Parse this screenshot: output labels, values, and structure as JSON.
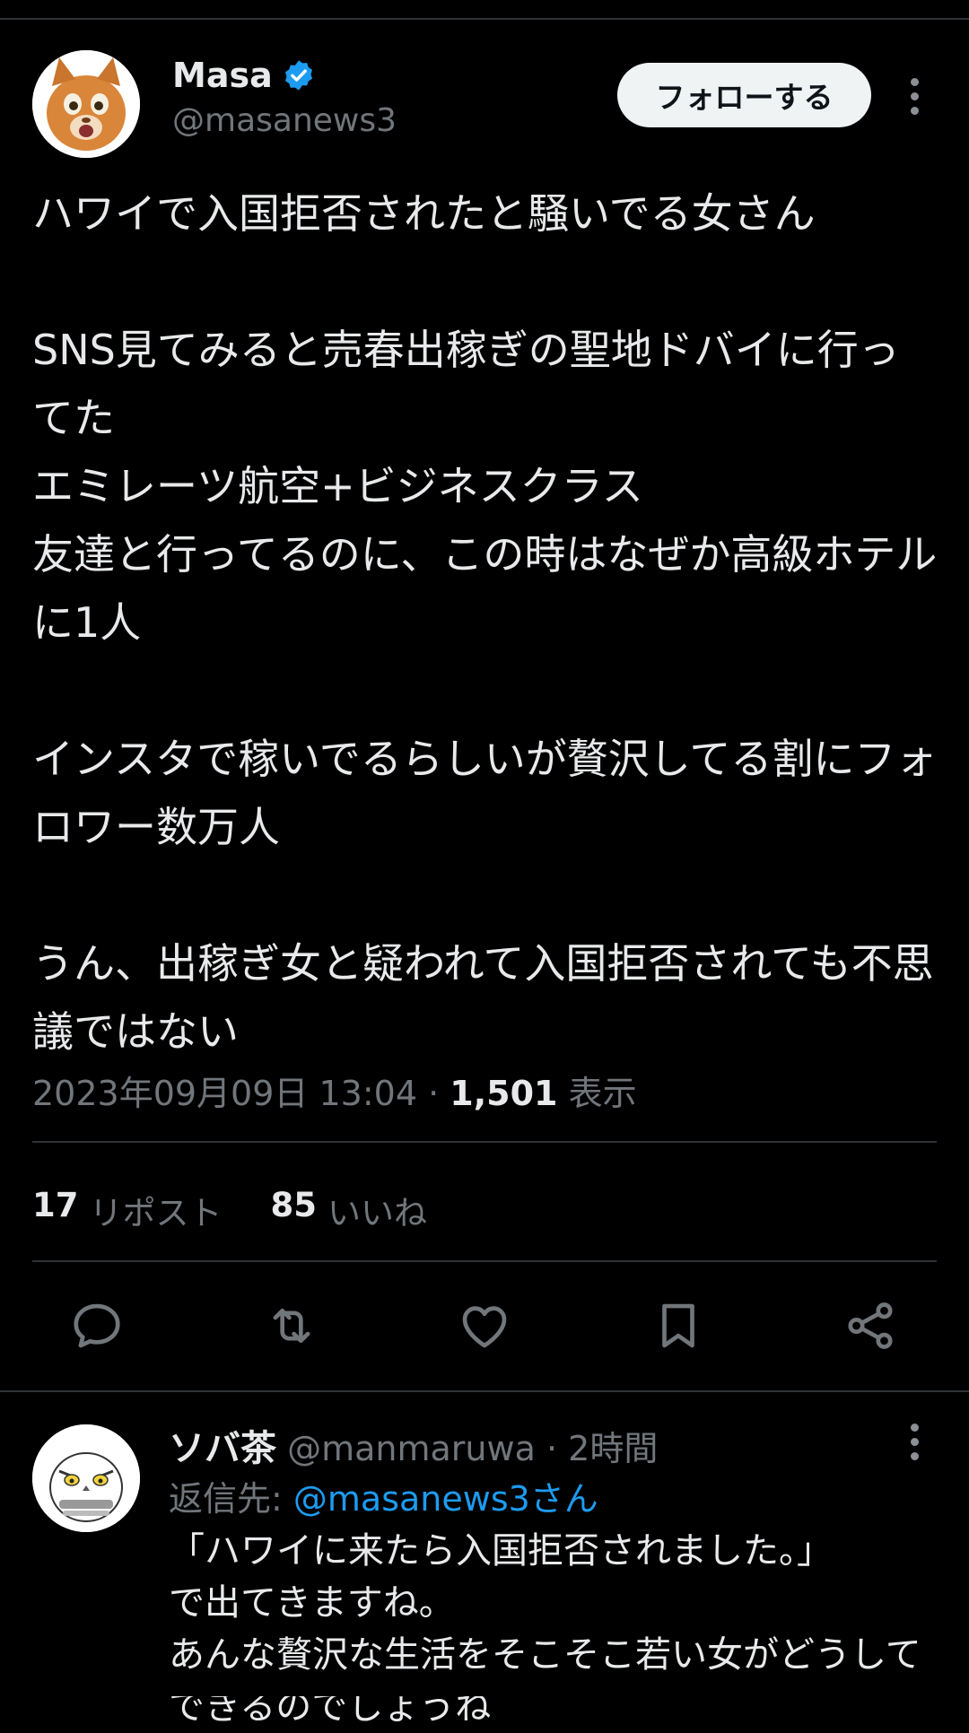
{
  "tweet": {
    "author_name": "Masa",
    "author_handle": "@masanews3",
    "follow_label": "フォローする",
    "text": "ハワイで入国拒否されたと騒いでる女さん\n\nSNS見てみると売春出稼ぎの聖地ドバイに行ってた\nエミレーツ航空+ビジネスクラス\n友達と行ってるのに、この時はなぜか高級ホテルに1人\n\nインスタで稼いでるらしいが贅沢してる割にフォロワー数万人\n\nうん、出稼ぎ女と疑われて入国拒否されても不思議ではない",
    "timestamp": "2023年09月09日 13:04",
    "separator": " · ",
    "views_count": "1,501",
    "views_label": "表示",
    "reposts_count": "17",
    "reposts_label": "リポスト",
    "likes_count": "85",
    "likes_label": "いいね"
  },
  "icons": {
    "reply": "reply-icon",
    "repost": "repost-icon",
    "like": "heart-icon",
    "bookmark": "bookmark-icon",
    "share": "share-icon",
    "verified": "verified-badge-icon",
    "more": "more-options-icon"
  },
  "reply": {
    "author_name": "ソバ茶",
    "author_handle": "@manmaruwa",
    "separator": "·",
    "time": "2時間",
    "reply_to_prefix": "返信先: ",
    "reply_to_mention": "@masanews3さん",
    "text": "「ハワイに来たら入国拒否されました。」\nで出てきますね。\nあんな贅沢な生活をそこそこ若い女がどうして\nできるのでしょうね"
  },
  "colors": {
    "background": "#000000",
    "text_primary": "#e7e9ea",
    "text_secondary": "#71767b",
    "accent": "#1d9bf0",
    "divider": "#2f3336"
  }
}
